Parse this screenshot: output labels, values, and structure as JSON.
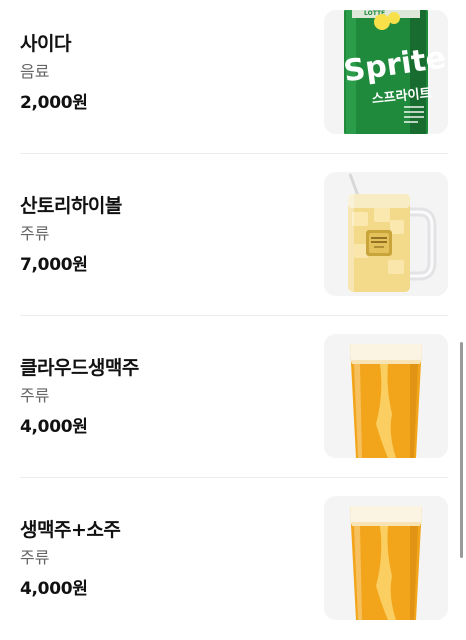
{
  "menu": {
    "items": [
      {
        "name": "사이다",
        "category": "음료",
        "price": "2,000원",
        "image": "sprite-can-image"
      },
      {
        "name": "산토리하이볼",
        "category": "주류",
        "price": "7,000원",
        "image": "highball-mug-image"
      },
      {
        "name": "클라우드생맥주",
        "category": "주류",
        "price": "4,000원",
        "image": "draft-beer-glass-image"
      },
      {
        "name": "생맥주+소주",
        "category": "주류",
        "price": "4,000원",
        "image": "draft-beer-glass-image"
      }
    ]
  },
  "product_labels": {
    "can_brand": "Sprite",
    "can_korean": "스프라이트",
    "can_maker": "LOTTE"
  },
  "colors": {
    "sprite_green": "#1f8a3c",
    "beer_amber": "#f2a51a",
    "highball_yellow": "#f3d98a",
    "divider": "#ececec"
  }
}
